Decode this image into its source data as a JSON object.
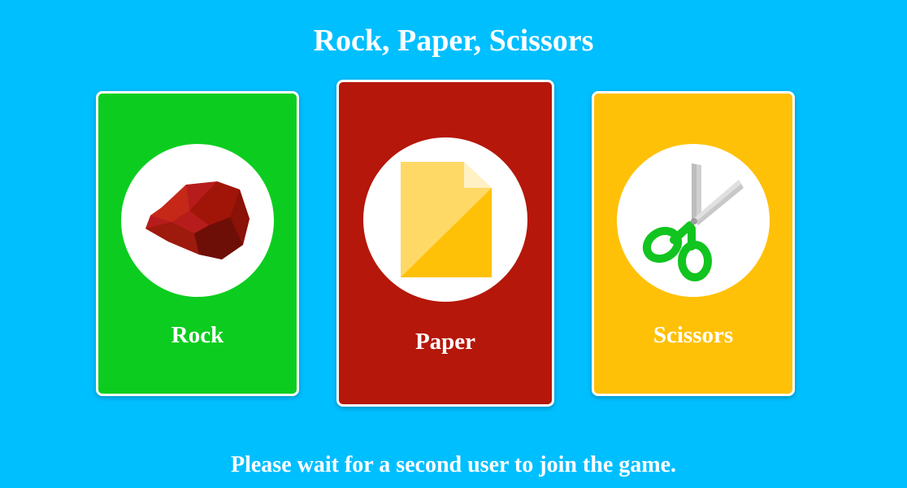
{
  "title": "Rock, Paper, Scissors",
  "cards": [
    {
      "id": "rock",
      "label": "Rock",
      "color": "#0ccd1f",
      "icon": "rock-icon"
    },
    {
      "id": "paper",
      "label": "Paper",
      "color": "#b5170a",
      "icon": "paper-icon"
    },
    {
      "id": "scissors",
      "label": "Scissors",
      "color": "#ffc107",
      "icon": "scissors-icon"
    }
  ],
  "status": "Please wait for a second user to join the game.",
  "colors": {
    "background": "#00bfff",
    "text": "#ffffff"
  }
}
